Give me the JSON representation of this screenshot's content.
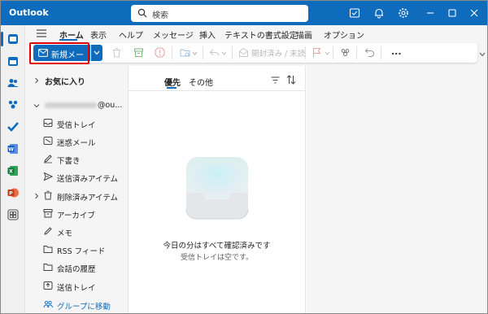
{
  "app": {
    "title": "Outlook"
  },
  "search": {
    "placeholder": "検索"
  },
  "ribbon": {
    "tabs": [
      "ホーム",
      "表示",
      "ヘルプ",
      "メッセージ",
      "挿入",
      "テキストの書式設定",
      "描画",
      "オプション"
    ],
    "active_tab": "ホーム"
  },
  "toolbar": {
    "new_mail_label": "新規メール",
    "read_unread_label": "開封済み / 未読",
    "more_label": "..."
  },
  "folders": {
    "favorites_label": "お気に入り",
    "account_suffix": "@ou...",
    "items": [
      {
        "label": "受信トレイ",
        "icon": "inbox-icon"
      },
      {
        "label": "迷惑メール",
        "icon": "junk-icon"
      },
      {
        "label": "下書き",
        "icon": "draft-icon"
      },
      {
        "label": "送信済みアイテム",
        "icon": "send-icon"
      },
      {
        "label": "削除済みアイテム",
        "icon": "trash-icon"
      },
      {
        "label": "アーカイブ",
        "icon": "archive-icon"
      },
      {
        "label": "メモ",
        "icon": "note-icon"
      },
      {
        "label": "RSS フィード",
        "icon": "folder-icon"
      },
      {
        "label": "会話の履歴",
        "icon": "folder-icon"
      },
      {
        "label": "送信トレイ",
        "icon": "outbox-icon"
      },
      {
        "label": "グループに移動",
        "icon": "group-icon"
      }
    ]
  },
  "message_list": {
    "pivots": [
      "優先",
      "その他"
    ],
    "active_pivot": "優先",
    "empty_title": "今日の分はすべて確認済みです",
    "empty_subtitle": "受信トレイは空です。"
  },
  "colors": {
    "brand": "#0f6cbd",
    "highlight": "#e00000"
  }
}
